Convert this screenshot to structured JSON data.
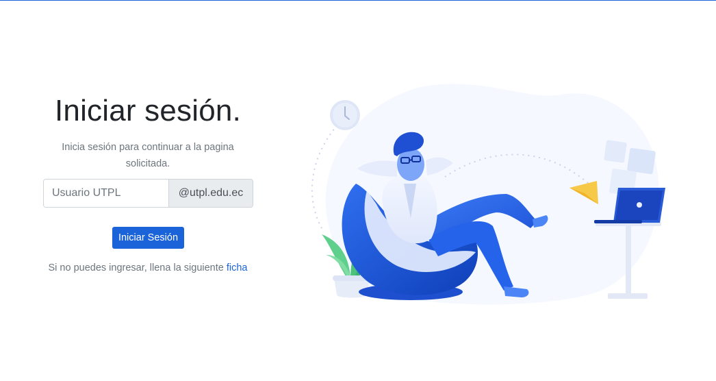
{
  "login": {
    "title": "Iniciar sesión.",
    "subtitle": "Inicia sesión para continuar a la pagina solicitada.",
    "username_placeholder": "Usuario UTPL",
    "username_value": "",
    "domain_suffix": "@utpl.edu.ec",
    "submit_label": "Iniciar Sesión",
    "help_text": "Si no puedes ingresar, llena la siguiente",
    "help_link_label": "ficha"
  },
  "colors": {
    "accent": "#1a63d8",
    "text_muted": "#6c757d",
    "addon_bg": "#e9ecef"
  },
  "illustration": {
    "icons": [
      "clock-icon",
      "paper-plane-icon",
      "laptop-icon",
      "plant-icon",
      "beanbag-person-illustration"
    ]
  }
}
